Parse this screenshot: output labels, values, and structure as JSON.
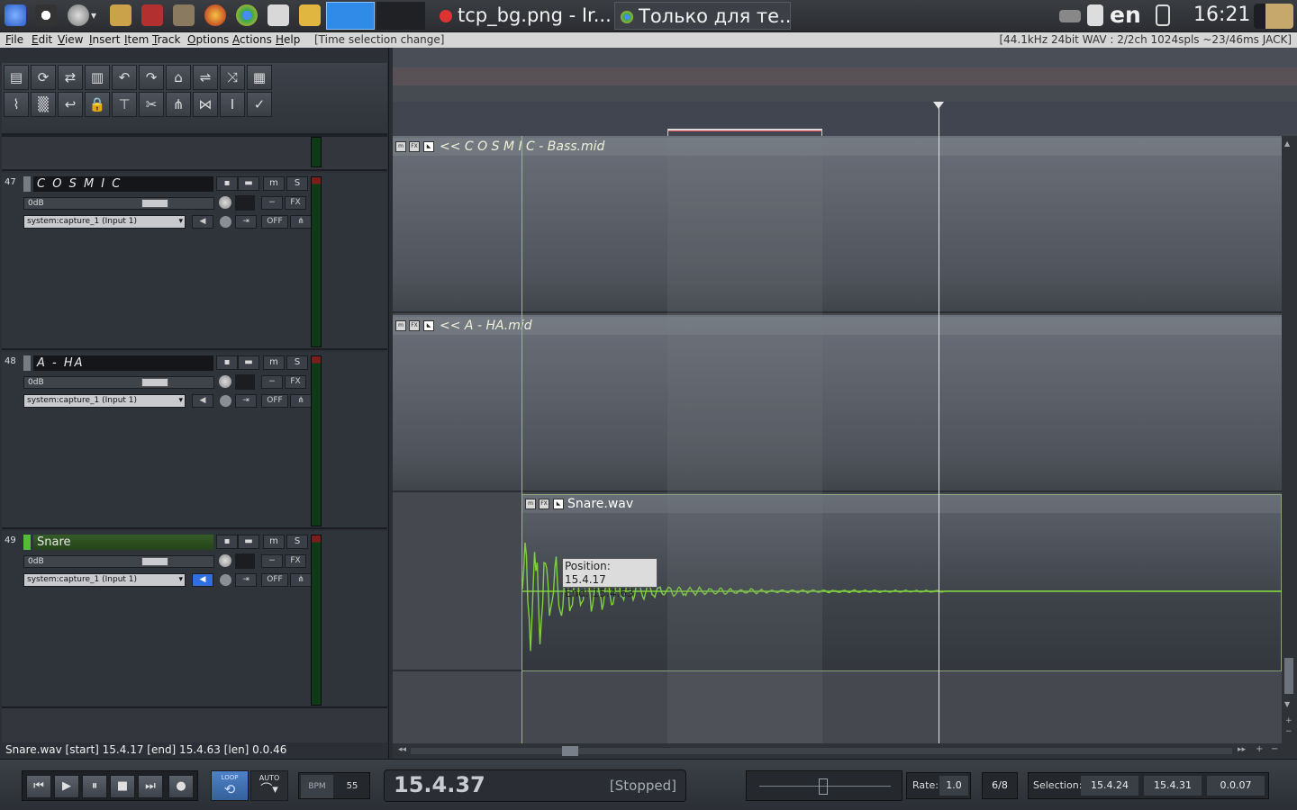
{
  "taskbar": {
    "task1_title": "tcp_bg.png - Ir...",
    "task2_title": "Только для те...",
    "lang": "en",
    "clock": "16:21"
  },
  "menubar": {
    "items": [
      "File",
      "Edit",
      "View",
      "Insert",
      "Item",
      "Track",
      "Options",
      "Actions",
      "Help"
    ],
    "status": "[Time selection change]",
    "audio_info": "[44.1kHz 24bit WAV : 2/2ch 1024spls ~23/46ms JACK]"
  },
  "toolbar": {
    "icons": [
      "new-project-icon",
      "open-project-icon",
      "save-project-icon",
      "project-settings-icon",
      "undo-icon",
      "redo-icon",
      "metronome-icon",
      "snap-icon",
      "ripple-edit-icon",
      "grid-icon",
      "envelope-icon",
      "grid-lines-icon",
      "loop-points-icon",
      "lock-icon",
      "item-properties-icon",
      "split-icon",
      "group-icon",
      "crossfade-icon",
      "cursor-icon",
      "auto-xfade-icon"
    ]
  },
  "tracks": [
    {
      "number": "47",
      "name": "C O S M I C",
      "volume": "0dB",
      "input": "system:capture_1 (Input 1)",
      "color": "#777b82",
      "item_title": "<< C O S M I C - Bass.mid",
      "buttons": {
        "env": "▪",
        "mute": "m",
        "solo": "S",
        "fx": "FX",
        "off": "OFF"
      }
    },
    {
      "number": "48",
      "name": "A - HA",
      "volume": "0dB",
      "input": "system:capture_1 (Input 1)",
      "color": "#777b82",
      "item_title": "<< A - HA.mid",
      "buttons": {
        "env": "▪",
        "mute": "m",
        "solo": "S",
        "fx": "FX",
        "off": "OFF"
      }
    },
    {
      "number": "49",
      "name": "Snare",
      "volume": "0dB",
      "input": "system:capture_1 (Input 1)",
      "color": "#4fbf3a",
      "item_title": "Snare.wav",
      "buttons": {
        "env": "▪",
        "mute": "m",
        "solo": "S",
        "fx": "FX",
        "off": "OFF"
      }
    }
  ],
  "tooltip": {
    "position": "Position: 15.4.17",
    "end": "End: 15.4.63"
  },
  "status_line": "Snare.wav [start] 15.4.17 [end] 15.4.63 [len] 0.0.46",
  "item_buttons": {
    "m": "m",
    "fx": "FX"
  },
  "transport": {
    "loop_label": "LOOP",
    "auto_label": "AUTO",
    "bpm_label": "BPM",
    "bpm_value": "55",
    "position": "15.4.37",
    "state": "[Stopped]",
    "rate_label": "Rate:",
    "rate_value": "1.0",
    "time_sig": "6/8",
    "selection_label": "Selection:",
    "selection_start": "15.4.24",
    "selection_end": "15.4.31",
    "selection_length": "0.0.07"
  },
  "colors": {
    "waveform": "#7fcf3f",
    "accent": "#2f8ae8"
  }
}
